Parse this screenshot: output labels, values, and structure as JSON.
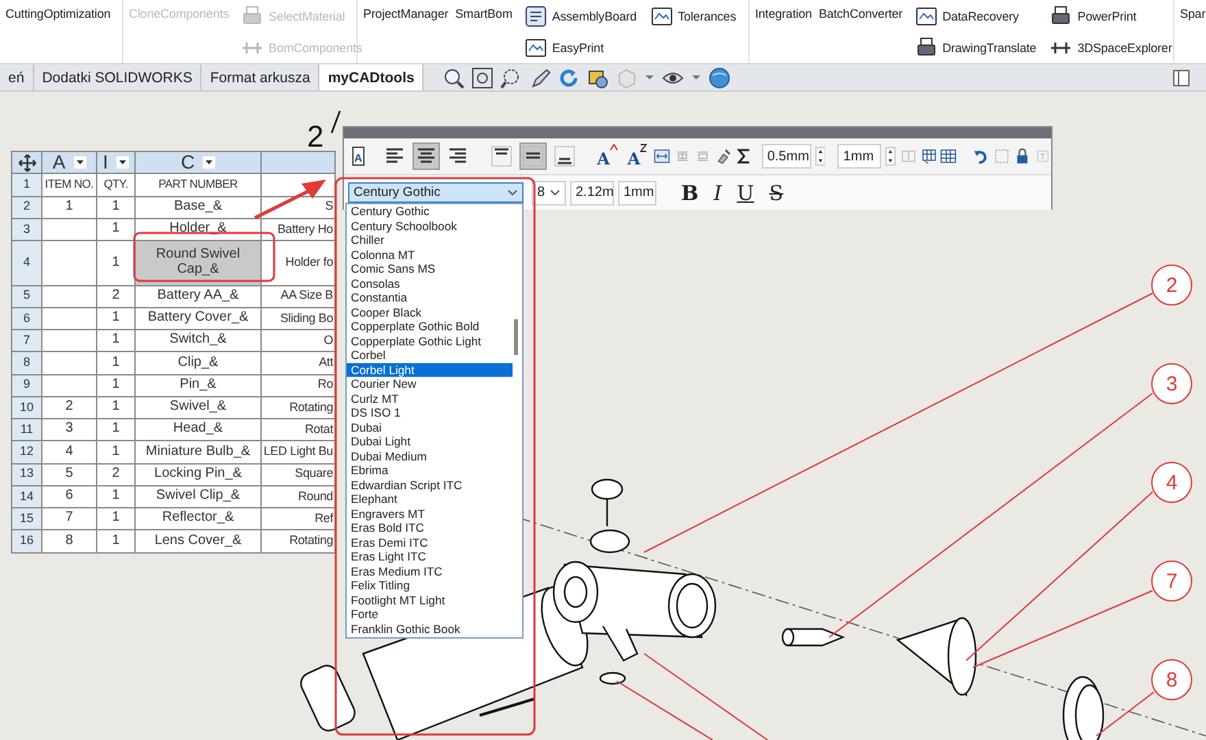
{
  "ribbon": {
    "groups": [
      {
        "items": [
          {
            "kind": "text",
            "label": "CuttingOptimization",
            "disabled": false
          }
        ]
      },
      {
        "items": [
          {
            "kind": "text",
            "label": "CloneComponents",
            "disabled": true
          },
          {
            "kind": "stack",
            "buttons": [
              {
                "label": "SelectMaterial",
                "disabled": true
              },
              {
                "label": "BomComponents",
                "disabled": true
              }
            ]
          }
        ]
      },
      {
        "items": [
          {
            "kind": "text",
            "label": "ProjectManager",
            "disabled": false
          },
          {
            "kind": "text",
            "label": "SmartBom",
            "disabled": false
          },
          {
            "kind": "stack",
            "buttons": [
              {
                "label": "AssemblyBoard",
                "disabled": false
              },
              {
                "label": "EasyPrint",
                "disabled": false
              }
            ]
          },
          {
            "kind": "stack",
            "buttons": [
              {
                "label": "Tolerances",
                "disabled": false
              }
            ]
          }
        ]
      },
      {
        "items": [
          {
            "kind": "text",
            "label": "Integration",
            "disabled": false
          },
          {
            "kind": "text",
            "label": "BatchConverter",
            "disabled": false
          },
          {
            "kind": "stack",
            "buttons": [
              {
                "label": "DataRecovery",
                "disabled": false
              },
              {
                "label": "DrawingTranslate",
                "disabled": false
              }
            ]
          },
          {
            "kind": "stack",
            "buttons": [
              {
                "label": "PowerPrint",
                "disabled": false
              },
              {
                "label": "3DSpaceExplorer",
                "disabled": false
              }
            ]
          }
        ]
      },
      {
        "items": [
          {
            "kind": "text",
            "label": "Spar",
            "disabled": false
          }
        ]
      }
    ]
  },
  "tabs": [
    {
      "label": "eń",
      "selected": false
    },
    {
      "label": "Dodatki SOLIDWORKS",
      "selected": false
    },
    {
      "label": "Format arkusza",
      "selected": false
    },
    {
      "label": "myCADtools",
      "selected": true
    }
  ],
  "sheet": {
    "balloon_label": "2"
  },
  "table": {
    "column_letters": [
      "A",
      "I",
      "C"
    ],
    "rows": [
      {
        "number": "1",
        "cells": [
          "ITEM NO.",
          "QTY.",
          "PART NUMBER",
          null
        ],
        "selected": false
      },
      {
        "number": "2",
        "cells": [
          "1",
          "1",
          "Base_&",
          "S"
        ],
        "selected": false
      },
      {
        "number": "3",
        "cells": [
          null,
          "1",
          "Holder_&",
          "Battery Ho"
        ],
        "selected": false
      },
      {
        "number": "4",
        "cells": [
          null,
          "1",
          "Round Swivel Cap_&",
          "Holder fo"
        ],
        "selected": true
      },
      {
        "number": "5",
        "cells": [
          null,
          "2",
          "Battery AA_&",
          "AA Size B"
        ],
        "selected": false
      },
      {
        "number": "6",
        "cells": [
          null,
          "1",
          "Battery Cover_&",
          "Sliding Bo"
        ],
        "selected": false
      },
      {
        "number": "7",
        "cells": [
          null,
          "1",
          "Switch_&",
          "O"
        ],
        "selected": false
      },
      {
        "number": "8",
        "cells": [
          null,
          "1",
          "Clip_&",
          "Att"
        ],
        "selected": false
      },
      {
        "number": "9",
        "cells": [
          null,
          "1",
          "Pin_&",
          "Ro"
        ],
        "selected": false
      },
      {
        "number": "10",
        "cells": [
          "2",
          "1",
          "Swivel_&",
          "Rotating"
        ],
        "selected": false
      },
      {
        "number": "11",
        "cells": [
          "3",
          "1",
          "Head_&",
          "Rotat"
        ],
        "selected": false
      },
      {
        "number": "12",
        "cells": [
          "4",
          "1",
          "Miniature Bulb_&",
          "LED Light Bu"
        ],
        "selected": false
      },
      {
        "number": "13",
        "cells": [
          "5",
          "2",
          "Locking Pin_&",
          "Square"
        ],
        "selected": false
      },
      {
        "number": "14",
        "cells": [
          "6",
          "1",
          "Swivel Clip_&",
          "Round"
        ],
        "selected": false
      },
      {
        "number": "15",
        "cells": [
          "7",
          "1",
          "Reflector_&",
          "Ref"
        ],
        "selected": false
      },
      {
        "number": "16",
        "cells": [
          "8",
          "1",
          "Lens Cover_&",
          "Rotating"
        ],
        "selected": false
      }
    ]
  },
  "format_toolbar": {
    "horizontal_align": [
      {
        "selected": false
      },
      {
        "selected": true
      },
      {
        "selected": false
      }
    ],
    "vertical_align": [
      {
        "selected": false
      },
      {
        "selected": true
      },
      {
        "selected": false
      }
    ],
    "icon_letters": [
      "A",
      "A",
      "A"
    ],
    "margin_value": "0.5mm",
    "spacing_value": "1mm",
    "font": "Century Gothic",
    "font_size": "8",
    "height_value": "2.12m",
    "width_value": "1mm",
    "style_buttons": [
      "B",
      "I",
      "U",
      "S"
    ]
  },
  "font_list": [
    {
      "label": "Century Gothic",
      "selected": false
    },
    {
      "label": "Century Schoolbook",
      "selected": false
    },
    {
      "label": "Chiller",
      "selected": false
    },
    {
      "label": "Colonna MT",
      "selected": false
    },
    {
      "label": "Comic Sans MS",
      "selected": false
    },
    {
      "label": "Consolas",
      "selected": false
    },
    {
      "label": "Constantia",
      "selected": false
    },
    {
      "label": "Cooper Black",
      "selected": false
    },
    {
      "label": "Copperplate Gothic Bold",
      "selected": false
    },
    {
      "label": "Copperplate Gothic Light",
      "selected": false
    },
    {
      "label": "Corbel",
      "selected": false
    },
    {
      "label": "Corbel Light",
      "selected": true
    },
    {
      "label": "Courier New",
      "selected": false
    },
    {
      "label": "Curlz MT",
      "selected": false
    },
    {
      "label": "DS ISO 1",
      "selected": false
    },
    {
      "label": "Dubai",
      "selected": false
    },
    {
      "label": "Dubai Light",
      "selected": false
    },
    {
      "label": "Dubai Medium",
      "selected": false
    },
    {
      "label": "Ebrima",
      "selected": false
    },
    {
      "label": "Edwardian Script ITC",
      "selected": false
    },
    {
      "label": "Elephant",
      "selected": false
    },
    {
      "label": "Engravers MT",
      "selected": false
    },
    {
      "label": "Eras Bold ITC",
      "selected": false
    },
    {
      "label": "Eras Demi ITC",
      "selected": false
    },
    {
      "label": "Eras Light ITC",
      "selected": false
    },
    {
      "label": "Eras Medium ITC",
      "selected": false
    },
    {
      "label": "Felix Titling",
      "selected": false
    },
    {
      "label": "Footlight MT Light",
      "selected": false
    },
    {
      "label": "Forte",
      "selected": false
    },
    {
      "label": "Franklin Gothic Book",
      "selected": false
    }
  ],
  "callouts": [
    {
      "number": "2"
    },
    {
      "number": "3"
    },
    {
      "number": "4"
    },
    {
      "number": "7"
    },
    {
      "number": "8"
    }
  ]
}
